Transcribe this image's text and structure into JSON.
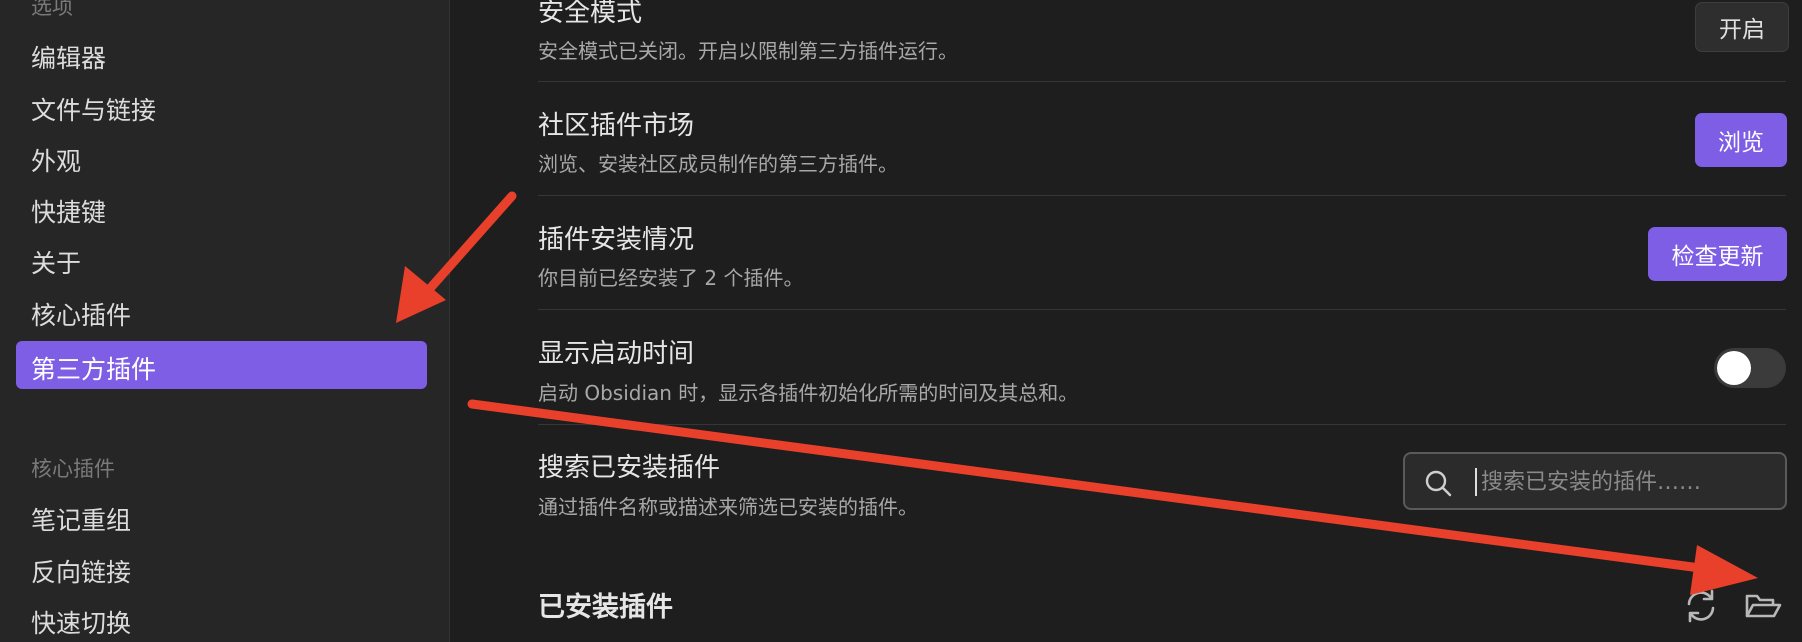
{
  "sidebar": {
    "section1_heading": "选项",
    "items": [
      "编辑器",
      "文件与链接",
      "外观",
      "快捷键",
      "关于",
      "核心插件",
      "第三方插件"
    ],
    "active_item": "第三方插件",
    "section2_heading": "核心插件",
    "section2_items": [
      "笔记重组",
      "反向链接",
      "快速切换"
    ]
  },
  "settings": {
    "safe_mode": {
      "title": "安全模式",
      "desc": "安全模式已关闭。开启以限制第三方插件运行。",
      "button": "开启"
    },
    "community": {
      "title": "社区插件市场",
      "desc": "浏览、安装社区成员制作的第三方插件。",
      "button": "浏览"
    },
    "installed_status": {
      "title": "插件安装情况",
      "desc": "你目前已经安装了 2 个插件。",
      "button": "检查更新"
    },
    "startup_time": {
      "title": "显示启动时间",
      "desc": "启动 Obsidian 时，显示各插件初始化所需的时间及其总和。",
      "toggle_on": false
    },
    "search": {
      "title": "搜索已安装插件",
      "desc": "通过插件名称或描述来筛选已安装的插件。",
      "placeholder": "搜索已安装的插件……"
    }
  },
  "installed": {
    "title": "已安装插件"
  },
  "colors": {
    "accent": "#7f5ee6",
    "annotation_arrow": "#e8402a",
    "background": "#1e1e1e",
    "sidebar_bg": "#262626"
  },
  "icons": [
    "search-icon",
    "reload-icon",
    "folder-open-icon"
  ]
}
